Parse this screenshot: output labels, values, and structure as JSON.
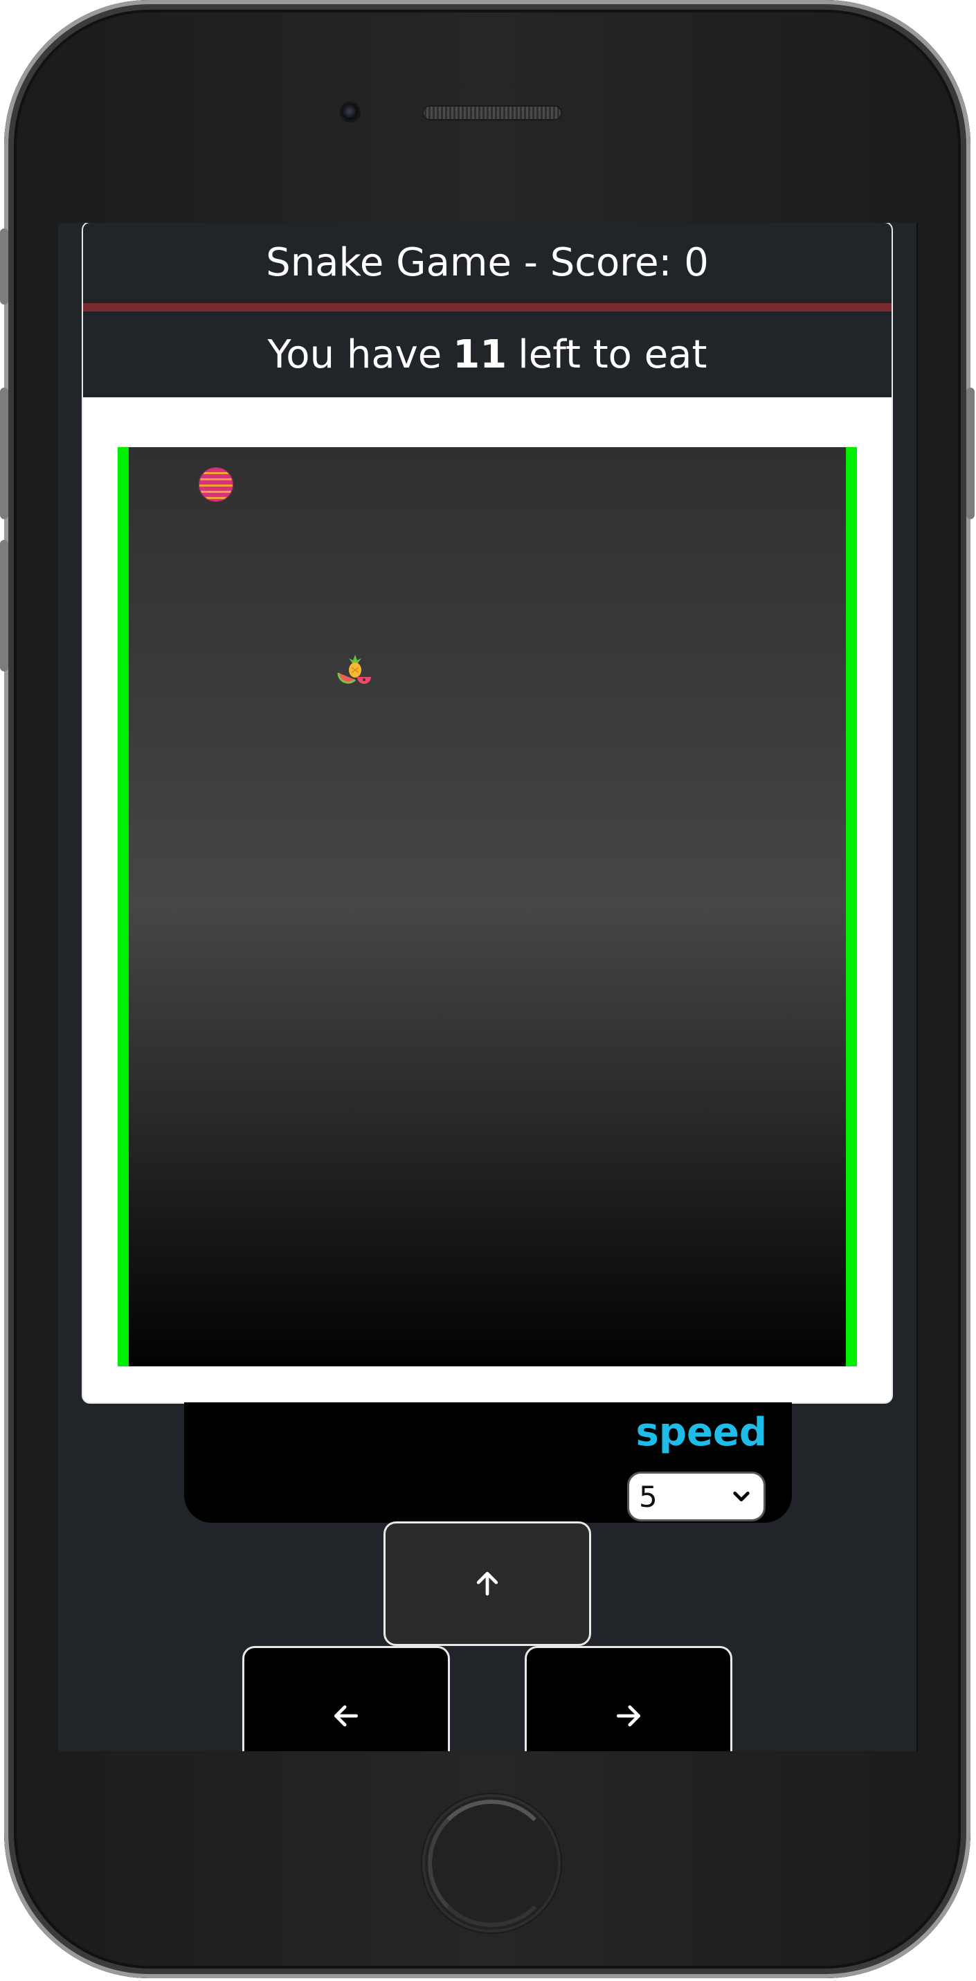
{
  "game": {
    "title": "Snake Game - Score: 0",
    "remaining_prefix": "You have",
    "remaining_count": "11",
    "remaining_suffix": "left to eat",
    "snake_head_icon": "striped-ball-icon",
    "food_icon": "fruit-bowl-icon"
  },
  "controls": {
    "speed_label": "speed",
    "speed_value": "5",
    "up_icon": "arrow-up-icon",
    "left_icon": "arrow-left-icon",
    "right_icon": "arrow-right-icon"
  },
  "colors": {
    "board_border": "#00ee00",
    "header_divider": "#7b2a2f",
    "speed_label": "#1ebce8",
    "snake_head": "#d8337a"
  }
}
